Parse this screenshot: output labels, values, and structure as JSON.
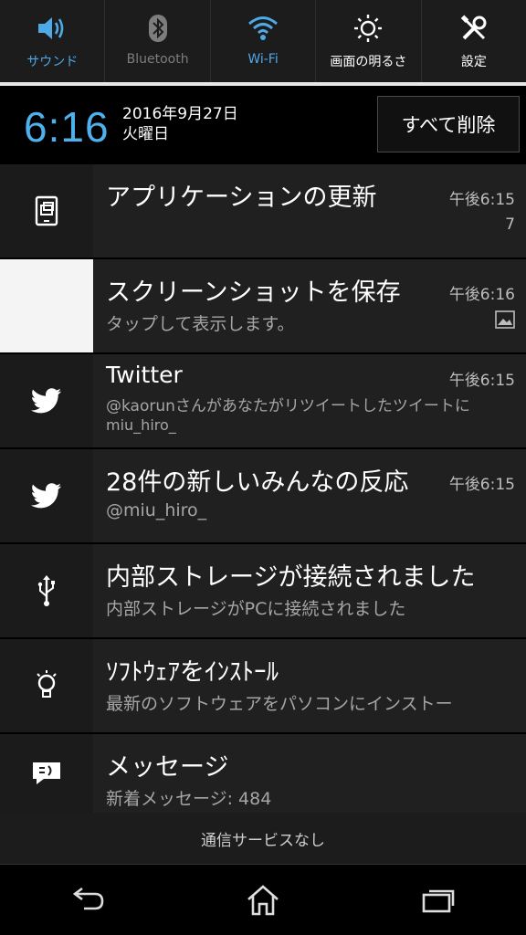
{
  "quick_settings": [
    {
      "label": "サウンド",
      "icon": "speaker-icon",
      "state": "on"
    },
    {
      "label": "Bluetooth",
      "icon": "bluetooth-icon",
      "state": "off"
    },
    {
      "label": "Wi-Fi",
      "icon": "wifi-icon",
      "state": "on"
    },
    {
      "label": "画面の明るさ",
      "icon": "brightness-icon",
      "state": "neutral"
    },
    {
      "label": "設定",
      "icon": "tools-icon",
      "state": "neutral"
    }
  ],
  "header": {
    "time": "6:16",
    "date": "2016年9月27日",
    "weekday": "火曜日",
    "clear_all": "すべて削除"
  },
  "notifications": [
    {
      "icon": "app-update-icon",
      "title": "アプリケーションの更新",
      "time": "午後6:15",
      "extra": "7"
    },
    {
      "icon": "screenshot-thumbnail",
      "title": "スクリーンショットを保存",
      "subtitle": "タップして表示します。",
      "time": "午後6:16",
      "extra_icon": "image-icon"
    },
    {
      "icon": "twitter-bird-icon",
      "title": "Twitter",
      "subtitle": "@kaorunさんがあなたがリツイートしたツイートに",
      "subtitle2": "miu_hiro_",
      "time": "午後6:15"
    },
    {
      "icon": "twitter-bird-icon",
      "title": "28件の新しいみんなの反応",
      "subtitle": "@miu_hiro_",
      "time": "午後6:15"
    },
    {
      "icon": "usb-icon",
      "title": "内部ストレージが接続されました",
      "subtitle": "内部ストレージがPCに接続されました"
    },
    {
      "icon": "lightbulb-icon",
      "title": "ｿﾌﾄｳｪｱをｲﾝｽﾄｰﾙ",
      "subtitle": "最新のソフトウェアをパソコンにインストー"
    },
    {
      "icon": "message-icon",
      "title": "メッセージ",
      "subtitle": "新着メッセージ: 484"
    }
  ],
  "status": {
    "no_service": "通信サービスなし"
  },
  "colors": {
    "accent": "#4fb1ec",
    "tile_on": "#4fa9e6",
    "tile_off": "#7d7d7d"
  }
}
